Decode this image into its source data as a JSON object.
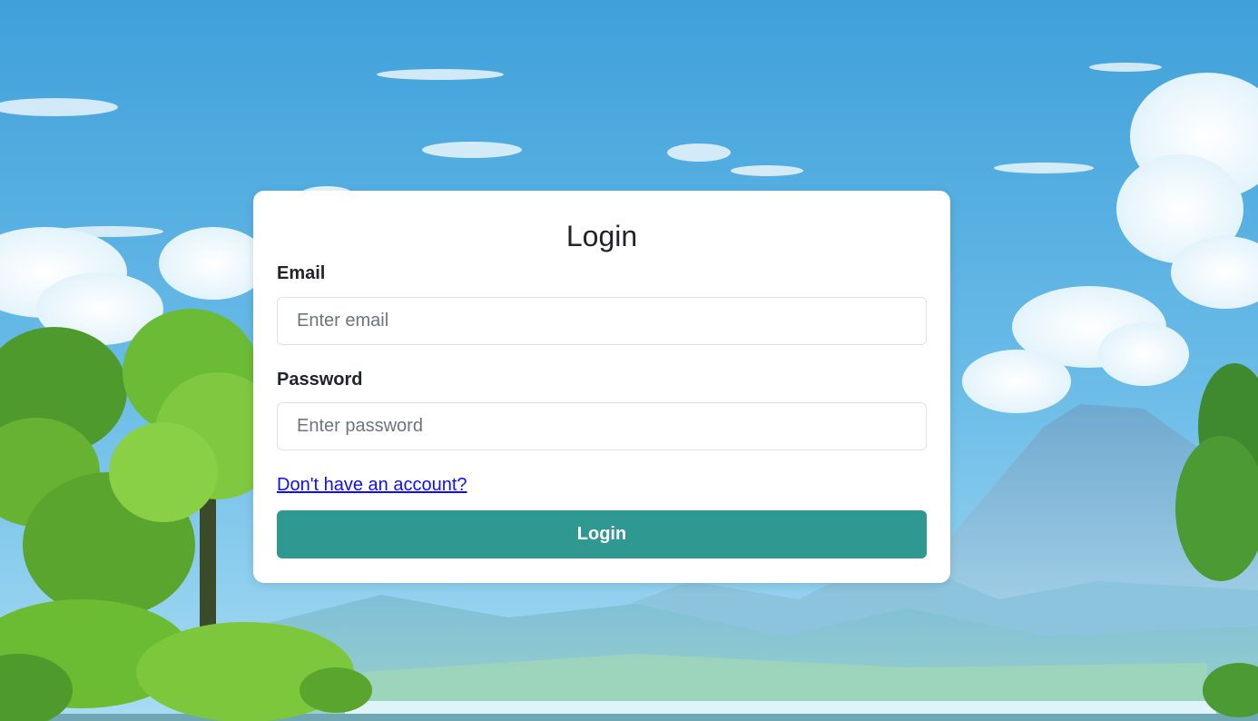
{
  "login": {
    "title": "Login",
    "email_label": "Email",
    "email_placeholder": "Enter email",
    "email_value": "",
    "password_label": "Password",
    "password_placeholder": "Enter password",
    "password_value": "",
    "signup_link": "Don't have an account?",
    "submit_label": "Login"
  },
  "colors": {
    "button": "#2e9891",
    "link": "#0d0dff",
    "sky_top": "#3fa0da",
    "sky_bottom": "#8fd0ef"
  }
}
